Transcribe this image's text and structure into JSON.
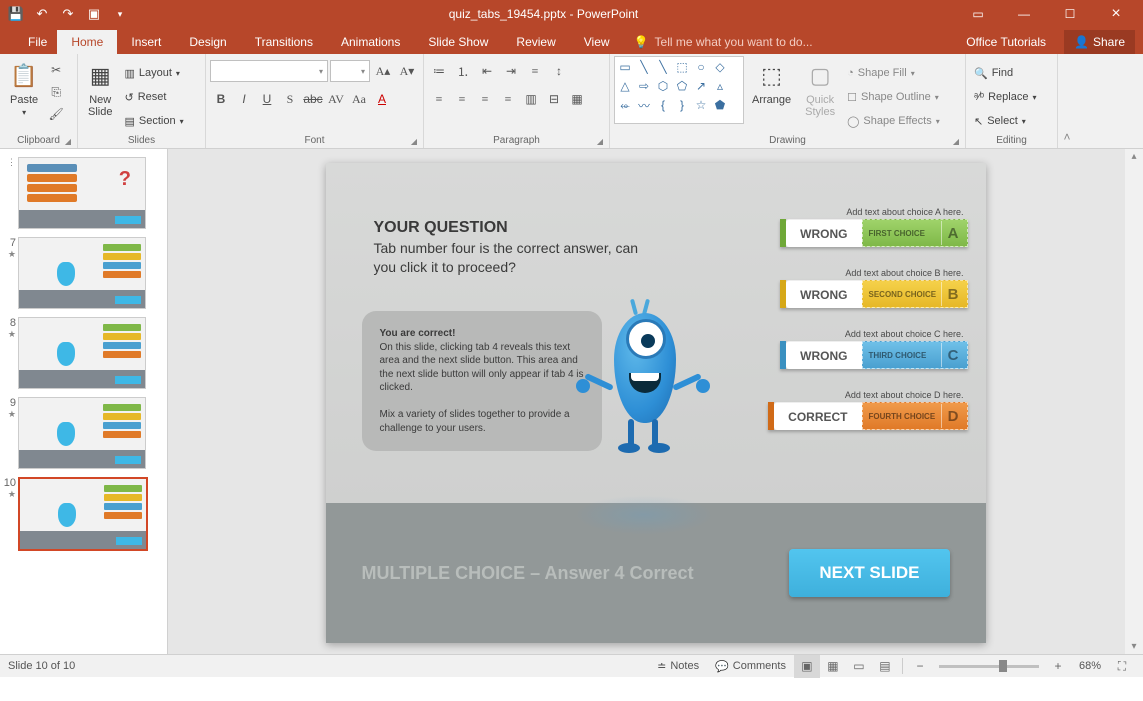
{
  "titlebar": {
    "filename": "quiz_tabs_19454.pptx",
    "app": "PowerPoint"
  },
  "tabs": {
    "file": "File",
    "list": [
      "Home",
      "Insert",
      "Design",
      "Transitions",
      "Animations",
      "Slide Show",
      "Review",
      "View"
    ],
    "active": "Home",
    "tellme": "Tell me what you want to do...",
    "tutorials": "Office Tutorials",
    "share": "Share"
  },
  "ribbon": {
    "clipboard": {
      "label": "Clipboard",
      "paste": "Paste"
    },
    "slides": {
      "label": "Slides",
      "new": "New\nSlide",
      "layout": "Layout",
      "reset": "Reset",
      "section": "Section"
    },
    "font": {
      "label": "Font"
    },
    "paragraph": {
      "label": "Paragraph"
    },
    "drawing": {
      "label": "Drawing",
      "arrange": "Arrange",
      "quick": "Quick\nStyles",
      "fill": "Shape Fill",
      "outline": "Shape Outline",
      "effects": "Shape Effects"
    },
    "editing": {
      "label": "Editing",
      "find": "Find",
      "replace": "Replace",
      "select": "Select"
    }
  },
  "thumbs": [
    {
      "n": "",
      "star": "⋮"
    },
    {
      "n": "7",
      "star": "★"
    },
    {
      "n": "8",
      "star": "★"
    },
    {
      "n": "9",
      "star": "★"
    },
    {
      "n": "10",
      "star": "★",
      "selected": true
    }
  ],
  "slide": {
    "qtitle": "YOUR QUESTION",
    "qtext": "Tab number four is the correct answer, can you click it to proceed?",
    "info_b": "You are correct!",
    "info1": "On this slide, clicking tab 4 reveals this text area and the next slide button. This area and the next slide button will only appear if tab 4 is clicked.",
    "info2": "Mix a variety of slides together to provide a challenge to your users.",
    "choices": [
      {
        "hint": "Add text about choice A here.",
        "result": "WRONG",
        "label": "FIRST CHOICE",
        "letter": "A",
        "cls": "c-green"
      },
      {
        "hint": "Add text about choice B here.",
        "result": "WRONG",
        "label": "SECOND CHOICE",
        "letter": "B",
        "cls": "c-yellow"
      },
      {
        "hint": "Add text about choice C here.",
        "result": "WRONG",
        "label": "THIRD CHOICE",
        "letter": "C",
        "cls": "c-blue"
      },
      {
        "hint": "Add text about choice D here.",
        "result": "CORRECT",
        "label": "FOURTH CHOICE",
        "letter": "D",
        "cls": "c-orange"
      }
    ],
    "mc": "MULTIPLE CHOICE – Answer 4 Correct",
    "next": "NEXT SLIDE"
  },
  "status": {
    "slide": "Slide 10 of 10",
    "notes": "Notes",
    "comments": "Comments",
    "zoom": "68%"
  }
}
